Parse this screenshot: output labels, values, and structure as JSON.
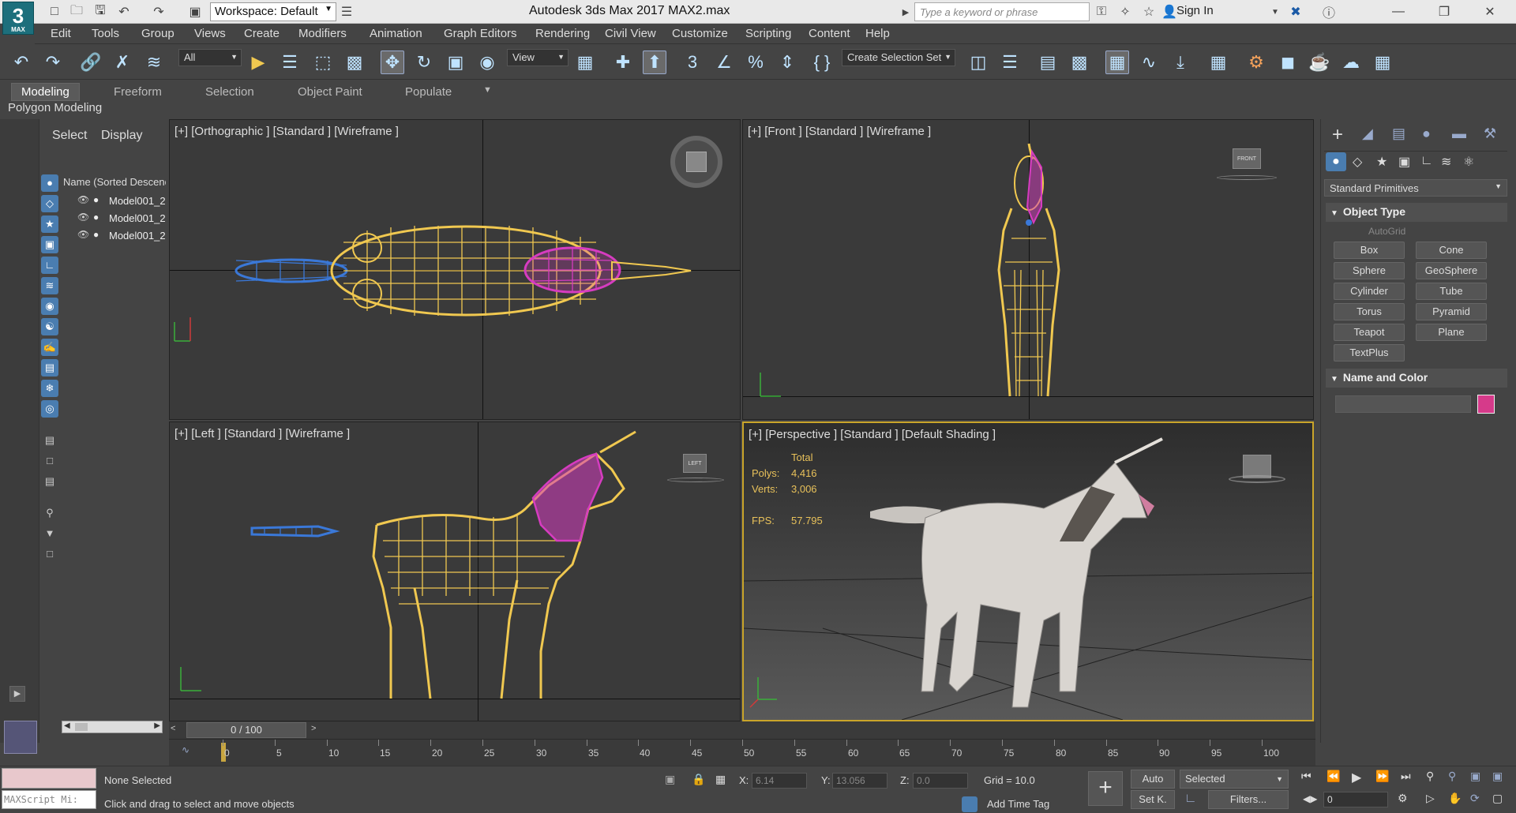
{
  "titlebar": {
    "app_icon": "3",
    "app_icon_sub": "MAX",
    "workspace": "Workspace: Default",
    "window_title": "Autodesk 3ds Max 2017     MAX2.max",
    "search_placeholder": "Type a keyword or phrase",
    "sign_in": "Sign In"
  },
  "menu": [
    "Edit",
    "Tools",
    "Group",
    "Views",
    "Create",
    "Modifiers",
    "Animation",
    "Graph Editors",
    "Rendering",
    "Civil View",
    "Customize",
    "Scripting",
    "Content",
    "Help"
  ],
  "toolbar": {
    "filter_all": "All",
    "ref_coord": "View",
    "selection_set": "Create Selection Set"
  },
  "ribbon": {
    "tabs": [
      "Modeling",
      "Freeform",
      "Selection",
      "Object Paint",
      "Populate"
    ],
    "panel": "Polygon Modeling"
  },
  "explorer": {
    "tab_select": "Select",
    "tab_display": "Display",
    "column": "Name (Sorted Descending)",
    "rows": [
      "Model001_2",
      "Model001_2",
      "Model001_2"
    ]
  },
  "viewports": {
    "top_left": "[+] [Orthographic ] [Standard ] [Wireframe ]",
    "top_right": "[+] [Front ] [Standard ] [Wireframe ]",
    "bottom_left": "[+] [Left ] [Standard ] [Wireframe ]",
    "bottom_right": "[+] [Perspective ] [Standard ] [Default Shading ]",
    "stats": {
      "total": "Total",
      "polys_label": "Polys:",
      "polys_value": "4,416",
      "verts_label": "Verts:",
      "verts_value": "3,006",
      "fps_label": "FPS:",
      "fps_value": "57.795"
    },
    "viewcube_front": "FRONT",
    "viewcube_left": "LEFT"
  },
  "command_panel": {
    "category": "Standard Primitives",
    "object_type": "Object Type",
    "autogrid": "AutoGrid",
    "buttons": [
      "Box",
      "Cone",
      "Sphere",
      "GeoSphere",
      "Cylinder",
      "Tube",
      "Torus",
      "Pyramid",
      "Teapot",
      "Plane",
      "TextPlus"
    ],
    "name_and_color": "Name and Color",
    "object_color": "#d63a8a"
  },
  "timeline": {
    "frame": "0 / 100",
    "ticks": [
      "0",
      "5",
      "10",
      "15",
      "20",
      "25",
      "30",
      "35",
      "40",
      "45",
      "50",
      "55",
      "60",
      "65",
      "70",
      "75",
      "80",
      "85",
      "90",
      "95",
      "100"
    ]
  },
  "status": {
    "maxscript": "MAXScript Mi:",
    "selection": "None Selected",
    "prompt": "Click and drag to select and move objects",
    "x_label": "X:",
    "x_value": "6.14",
    "y_label": "Y:",
    "y_value": "13.056",
    "z_label": "Z:",
    "z_value": "0.0",
    "grid": "Grid = 10.0",
    "add_time_tag": "Add Time Tag",
    "auto": "Auto",
    "set_key": "Set K.",
    "selected": "Selected",
    "filters": "Filters...",
    "current_frame": "0"
  },
  "colors": {
    "mesh_yellow": "#f0c850",
    "mane_magenta": "#d63cc0",
    "tail_blue": "#3a78d8",
    "active_viewport": "#caa52a"
  }
}
